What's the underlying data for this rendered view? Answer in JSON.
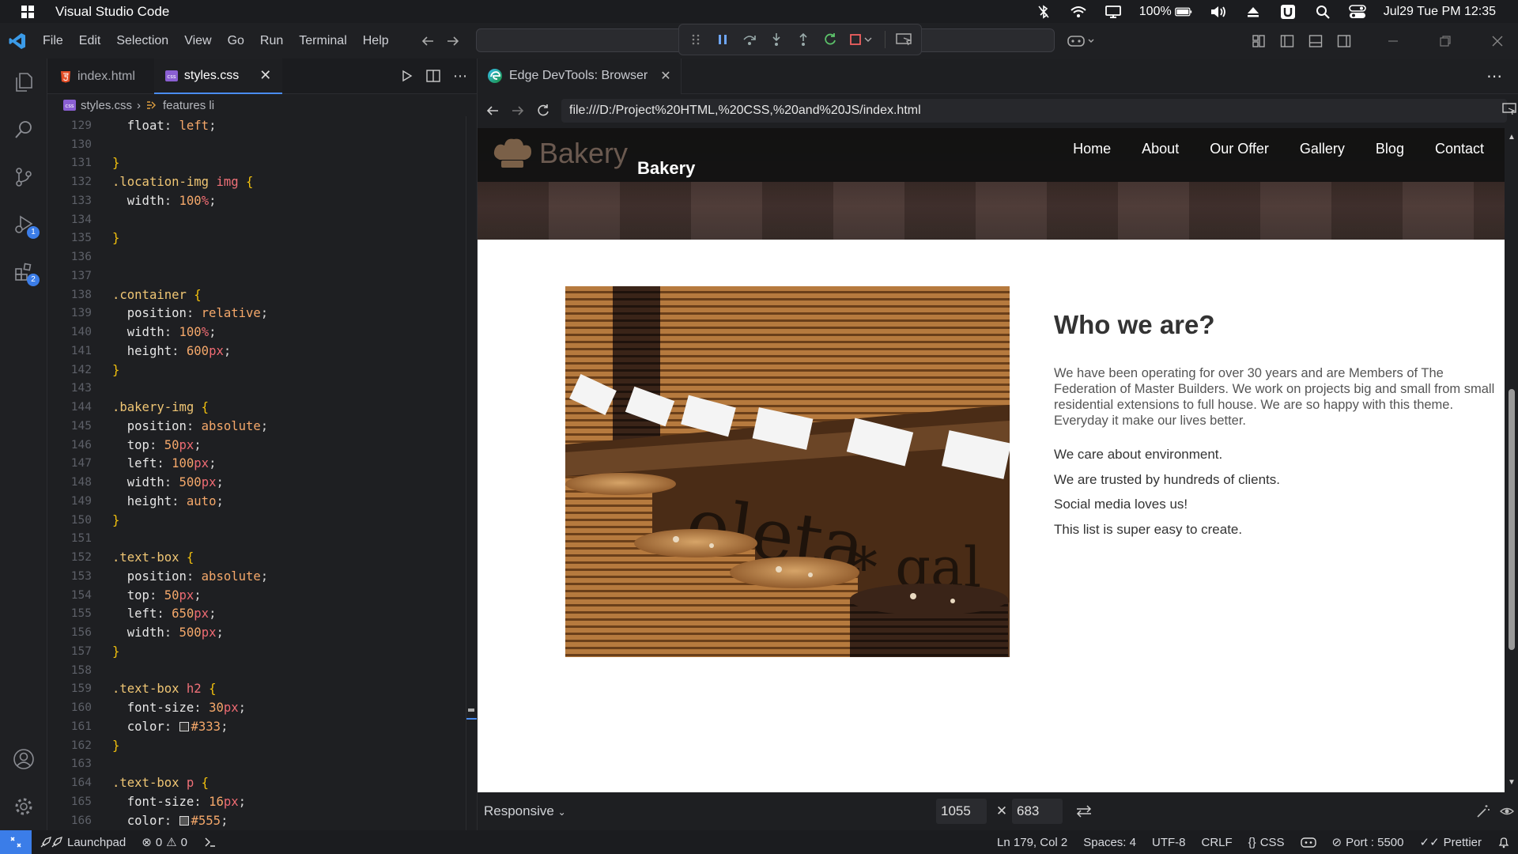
{
  "mac_bar": {
    "app_name": "Visual Studio Code",
    "battery": "100%",
    "datetime": "Jul29 Tue PM 12:35"
  },
  "menubar": {
    "items": [
      "File",
      "Edit",
      "Selection",
      "View",
      "Go",
      "Run",
      "Terminal",
      "Help"
    ]
  },
  "editor": {
    "tabs": [
      {
        "label": "index.html",
        "icon": "html5-icon"
      },
      {
        "label": "styles.css",
        "icon": "css-icon",
        "active": true
      }
    ],
    "breadcrumbs": {
      "file": "styles.css",
      "symbol": "features li"
    },
    "code_lines": [
      {
        "n": "129",
        "html": "  <span class='p'>float</span>: <span class='v'>left</span>;"
      },
      {
        "n": "130",
        "html": ""
      },
      {
        "n": "131",
        "html": "<span class='b'>}</span>"
      },
      {
        "n": "132",
        "html": "<span class='s'>.location-img</span> <span class='t'>img</span> <span class='b'>{</span>"
      },
      {
        "n": "133",
        "html": "  <span class='p'>width</span>: <span class='v'>100</span><span class='u'>%</span>;"
      },
      {
        "n": "134",
        "html": ""
      },
      {
        "n": "135",
        "html": "<span class='b'>}</span>"
      },
      {
        "n": "136",
        "html": ""
      },
      {
        "n": "137",
        "html": ""
      },
      {
        "n": "138",
        "html": "<span class='s'>.container</span> <span class='b'>{</span>"
      },
      {
        "n": "139",
        "html": "  <span class='p'>position</span>: <span class='v'>relative</span>;"
      },
      {
        "n": "140",
        "html": "  <span class='p'>width</span>: <span class='v'>100</span><span class='u'>%</span>;"
      },
      {
        "n": "141",
        "html": "  <span class='p'>height</span>: <span class='v'>600</span><span class='u'>px</span>;"
      },
      {
        "n": "142",
        "html": "<span class='b'>}</span>"
      },
      {
        "n": "143",
        "html": ""
      },
      {
        "n": "144",
        "html": "<span class='s'>.bakery-img</span> <span class='b'>{</span>"
      },
      {
        "n": "145",
        "html": "  <span class='p'>position</span>: <span class='v'>absolute</span>;"
      },
      {
        "n": "146",
        "html": "  <span class='p'>top</span>: <span class='v'>50</span><span class='u'>px</span>;"
      },
      {
        "n": "147",
        "html": "  <span class='p'>left</span>: <span class='v'>100</span><span class='u'>px</span>;"
      },
      {
        "n": "148",
        "html": "  <span class='p'>width</span>: <span class='v'>500</span><span class='u'>px</span>;"
      },
      {
        "n": "149",
        "html": "  <span class='p'>height</span>: <span class='v'>auto</span>;"
      },
      {
        "n": "150",
        "html": "<span class='b'>}</span>"
      },
      {
        "n": "151",
        "html": ""
      },
      {
        "n": "152",
        "html": "<span class='s'>.text-box</span> <span class='b'>{</span>"
      },
      {
        "n": "153",
        "html": "  <span class='p'>position</span>: <span class='v'>absolute</span>;"
      },
      {
        "n": "154",
        "html": "  <span class='p'>top</span>: <span class='v'>50</span><span class='u'>px</span>;"
      },
      {
        "n": "155",
        "html": "  <span class='p'>left</span>: <span class='v'>650</span><span class='u'>px</span>;"
      },
      {
        "n": "156",
        "html": "  <span class='p'>width</span>: <span class='v'>500</span><span class='u'>px</span>;"
      },
      {
        "n": "157",
        "html": "<span class='b'>}</span>"
      },
      {
        "n": "158",
        "html": ""
      },
      {
        "n": "159",
        "html": "<span class='s'>.text-box</span> <span class='t'>h2</span> <span class='b'>{</span>"
      },
      {
        "n": "160",
        "html": "  <span class='p'>font-size</span>: <span class='v'>30</span><span class='u'>px</span>;"
      },
      {
        "n": "161",
        "html": "  <span class='p'>color</span>: <span class='sw' style='background:#333'></span><span class='v'>#333</span>;"
      },
      {
        "n": "162",
        "html": "<span class='b'>}</span>"
      },
      {
        "n": "163",
        "html": ""
      },
      {
        "n": "164",
        "html": "<span class='s'>.text-box</span> <span class='t'>p</span> <span class='b'>{</span>"
      },
      {
        "n": "165",
        "html": "  <span class='p'>font-size</span>: <span class='v'>16</span><span class='u'>px</span>;"
      },
      {
        "n": "166",
        "html": "  <span class='p'>color</span>: <span class='sw' style='background:#555'></span><span class='v'>#555</span>;"
      }
    ]
  },
  "browser": {
    "tab_label": "Edge DevTools: Browser",
    "url": "file:///D:/Project%20HTML,%20CSS,%20and%20JS/index.html",
    "page": {
      "logo_text": "Bakery",
      "brand": "Bakery",
      "nav": [
        "Home",
        "About",
        "Our Offer",
        "Gallery",
        "Blog",
        "Contact"
      ],
      "heading": "Who we are?",
      "paragraph": "We have been operating for over 30 years and are Members of The Federation of Master Builders. We work on projects big and small from small residential extensions to full house. We are so happy with this theme. Everyday it make our lives better.",
      "features": [
        "We care about environment.",
        "We are trusted by hundreds of clients.",
        "Social media loves us!",
        "This list is super easy to create."
      ]
    },
    "device": {
      "mode": "Responsive",
      "width": "1055",
      "height": "683"
    }
  },
  "status": {
    "launchpad": "Launchpad",
    "errors": "0",
    "warnings": "0",
    "position": "Ln 179, Col 2",
    "spaces": "Spaces: 4",
    "encoding": "UTF-8",
    "eol": "CRLF",
    "language": "CSS",
    "port": "Port : 5500",
    "formatter": "Prettier"
  }
}
